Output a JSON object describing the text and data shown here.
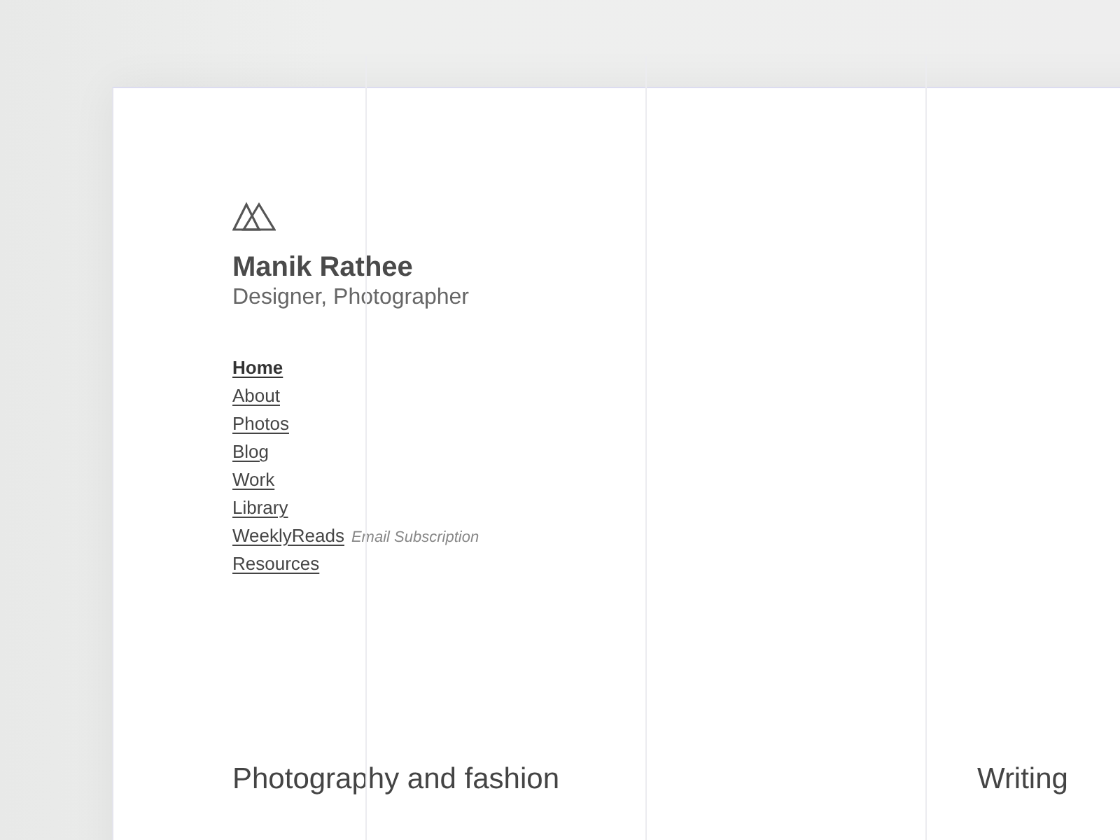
{
  "profile": {
    "name": "Manik Rathee",
    "tagline": "Designer, Photographer"
  },
  "nav": [
    {
      "label": "Home",
      "selected": true
    },
    {
      "label": "About",
      "selected": false
    },
    {
      "label": "Photos",
      "selected": false
    },
    {
      "label": "Blog",
      "selected": false
    },
    {
      "label": "Work",
      "selected": false
    },
    {
      "label": "Library",
      "selected": false
    },
    {
      "label": "WeeklyReads",
      "selected": false,
      "note": "Email Subscription"
    },
    {
      "label": "Resources",
      "selected": false
    }
  ],
  "sections": [
    {
      "title": "Photography and fashion"
    },
    {
      "title": "Writing"
    }
  ]
}
